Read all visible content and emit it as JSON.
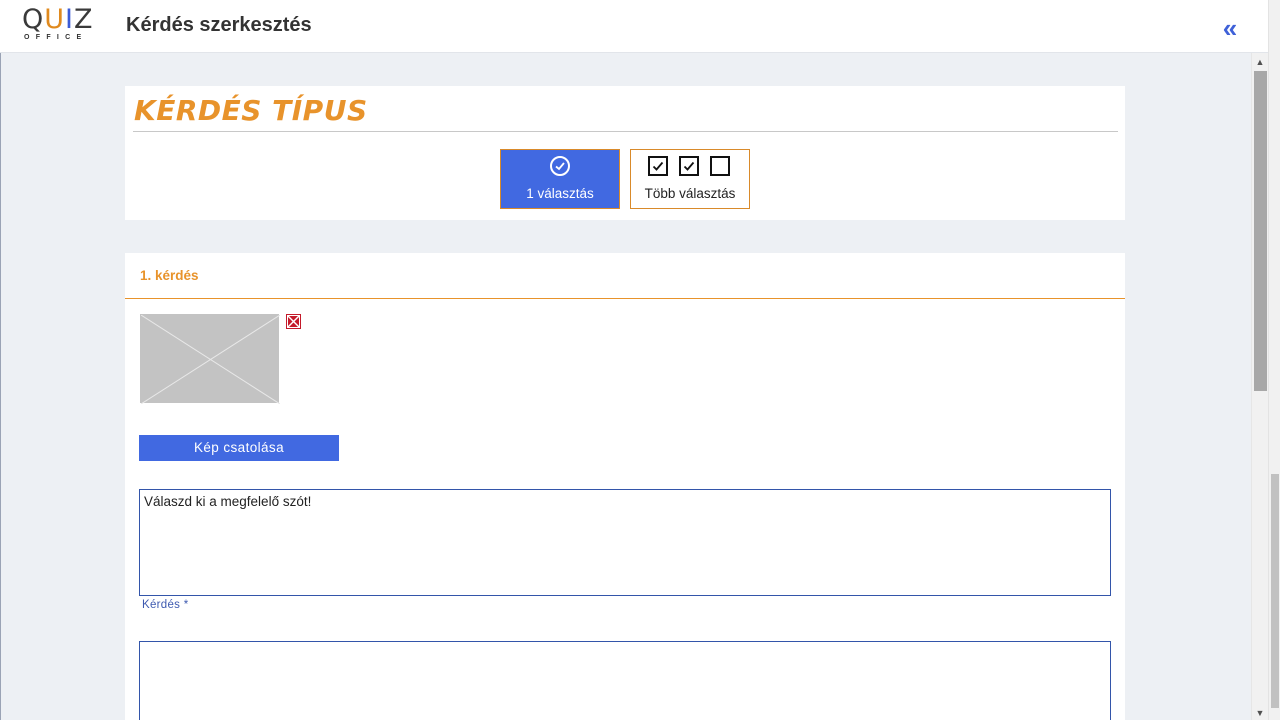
{
  "header": {
    "logo_main": [
      "Q",
      "U",
      "I",
      "Z"
    ],
    "logo_sub": "OFFICE",
    "title": "Kérdés szerkesztés",
    "collapse_icon": "double-chevron-left-icon"
  },
  "question_type": {
    "title": "KÉRDÉS TÍPUS",
    "options": [
      {
        "label": "1 választás",
        "icon": "check-circle-icon",
        "selected": true
      },
      {
        "label": "Több választás",
        "icon": "checkbox-group-icon",
        "selected": false
      }
    ]
  },
  "question": {
    "header": "1. kérdés",
    "image_placeholder_icon": "image-placeholder-icon",
    "delete_image_icon": "close-icon",
    "attach_button": "Kép csatolása",
    "text_value": "Válaszd ki a megfelelő szót!",
    "text_label": "Kérdés *",
    "answer_value": ""
  },
  "colors": {
    "accent_blue": "#4169e1",
    "accent_orange": "#e8932b",
    "background": "#edf0f4",
    "danger": "#c41a2a"
  }
}
